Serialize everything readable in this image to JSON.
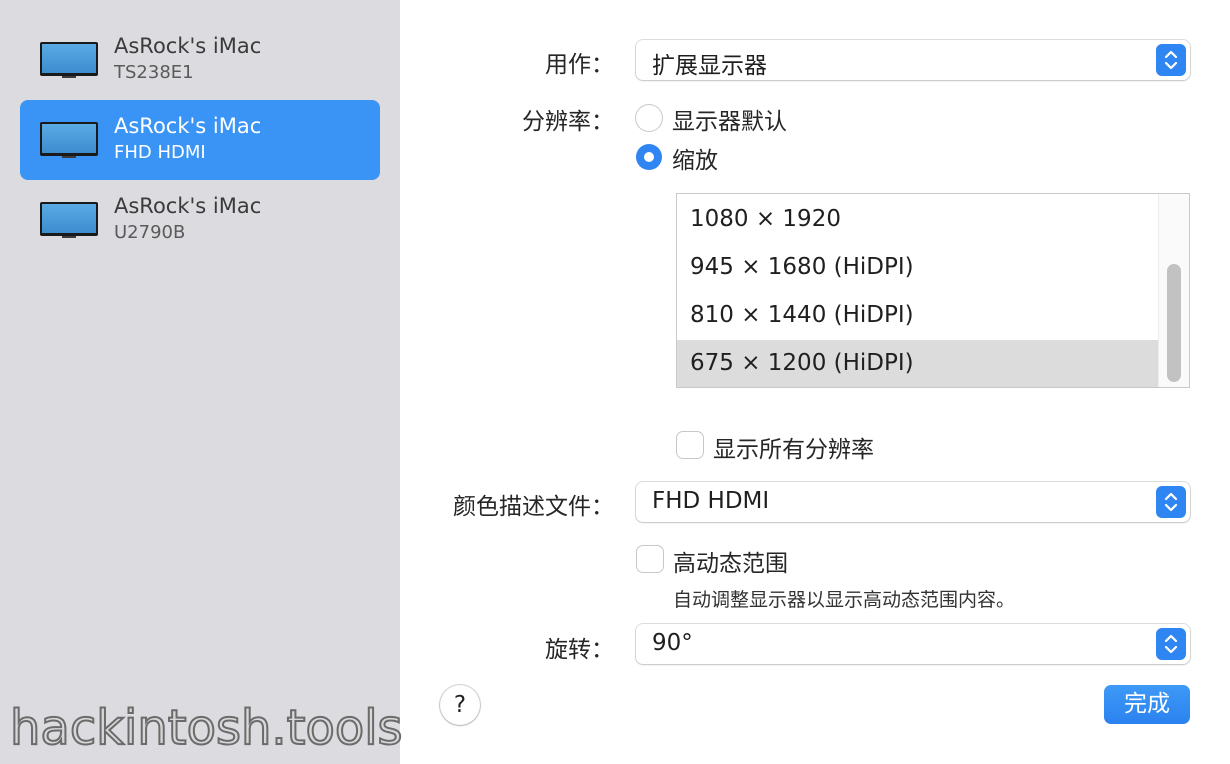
{
  "sidebar": {
    "displays": [
      {
        "name": "AsRock's iMac",
        "model": "TS238E1",
        "selected": false
      },
      {
        "name": "AsRock's iMac",
        "model": "FHD HDMI",
        "selected": true
      },
      {
        "name": "AsRock's iMac",
        "model": "U2790B",
        "selected": false
      }
    ],
    "watermark": "hackintosh.tools"
  },
  "use_as": {
    "label": "用作：",
    "value": "扩展显示器"
  },
  "resolution": {
    "label": "分辨率：",
    "options": [
      {
        "label": "显示器默认",
        "selected": false
      },
      {
        "label": "缩放",
        "selected": true
      }
    ],
    "list": [
      {
        "text": "1080 × 1920",
        "selected": false
      },
      {
        "text": "945 × 1680 (HiDPI)",
        "selected": false
      },
      {
        "text": "810 × 1440 (HiDPI)",
        "selected": false
      },
      {
        "text": "675 × 1200 (HiDPI)",
        "selected": true
      }
    ],
    "show_all_label": "显示所有分辨率",
    "show_all_checked": false
  },
  "color_profile": {
    "label": "颜色描述文件：",
    "value": "FHD HDMI"
  },
  "hdr": {
    "label": "高动态范围",
    "checked": false,
    "hint": "自动调整显示器以显示高动态范围内容。"
  },
  "rotation": {
    "label": "旋转：",
    "value": "90°"
  },
  "buttons": {
    "help": "?",
    "done": "完成"
  },
  "colors": {
    "accent": "#2f86f2",
    "selection": "#3a94f5",
    "sidebar_bg": "#dcdbdf"
  }
}
